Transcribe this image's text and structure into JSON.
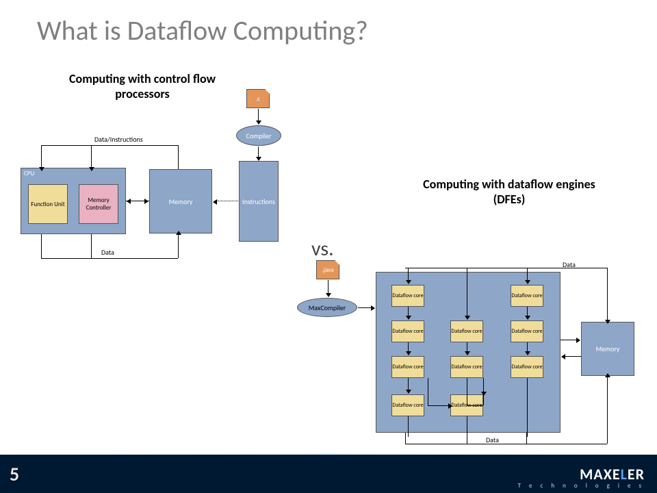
{
  "title": "What is Dataflow Computing?",
  "subtitle_left": "Computing with control flow processors",
  "subtitle_right": "Computing with dataflow engines (DFEs)",
  "vs": "vs.",
  "left": {
    "file": ".c",
    "compiler": "Compiler",
    "instructions": "Instructions",
    "memory": "Memory",
    "cpu": "CPU",
    "func_unit": "Function Unit",
    "mem_ctrl": "Memory Controller",
    "lbl_top": "Data/Instructions",
    "lbl_bottom": "Data"
  },
  "right": {
    "file": ".java",
    "compiler": "MaxCompiler",
    "core": "Dataflow core",
    "memory": "Memory",
    "lbl_top": "Data",
    "lbl_bottom": "Data"
  },
  "footer": {
    "page": "5",
    "brand": "MAXELER",
    "brand_accent": "L",
    "brand_sub": "T e c h n o l o g i e s"
  }
}
